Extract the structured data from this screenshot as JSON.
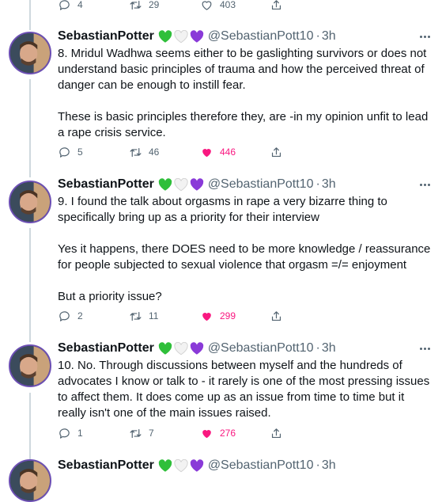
{
  "colors": {
    "like_active": "#f91880",
    "secondary_text": "#536471",
    "thread_line": "#cfd9de",
    "heart_green": "#2fbf3a",
    "heart_white": "#e6e6e6",
    "heart_purple": "#8a3ad8"
  },
  "top_actions": {
    "replies": "4",
    "retweets": "29",
    "likes": "403"
  },
  "tweets": [
    {
      "name": "SebastianPotter",
      "handle": "@SebastianPott10",
      "time": "3h",
      "paragraphs": [
        "8.  Mridul Wadhwa seems either to be gaslighting survivors or does not understand basic principles of trauma and how the perceived threat of danger can be enough to instill fear.",
        "These is basic principles therefore they, are -in my opinion unfit to lead a rape crisis service."
      ],
      "replies": "5",
      "retweets": "46",
      "likes": "446"
    },
    {
      "name": "SebastianPotter",
      "handle": "@SebastianPott10",
      "time": "3h",
      "paragraphs": [
        "9.  I found the talk about orgasms in rape a very bizarre thing to specifically bring up as a priority for their interview",
        "Yes it happens, there DOES need to be more knowledge / reassurance for people subjected to sexual violence that orgasm =/= enjoyment",
        "But a priority issue?"
      ],
      "replies": "2",
      "retweets": "11",
      "likes": "299"
    },
    {
      "name": "SebastianPotter",
      "handle": "@SebastianPott10",
      "time": "3h",
      "paragraphs": [
        "10. No.  Through discussions between myself and the hundreds of advocates I know or talk to - it rarely is one of the most pressing issues to affect them.   It does come up as an issue from time to time but it really isn't one of the main issues raised."
      ],
      "replies": "1",
      "retweets": "7",
      "likes": "276"
    },
    {
      "name": "SebastianPotter",
      "handle": "@SebastianPott10",
      "time": "3h",
      "paragraphs": [],
      "replies": "",
      "retweets": "",
      "likes": ""
    }
  ]
}
